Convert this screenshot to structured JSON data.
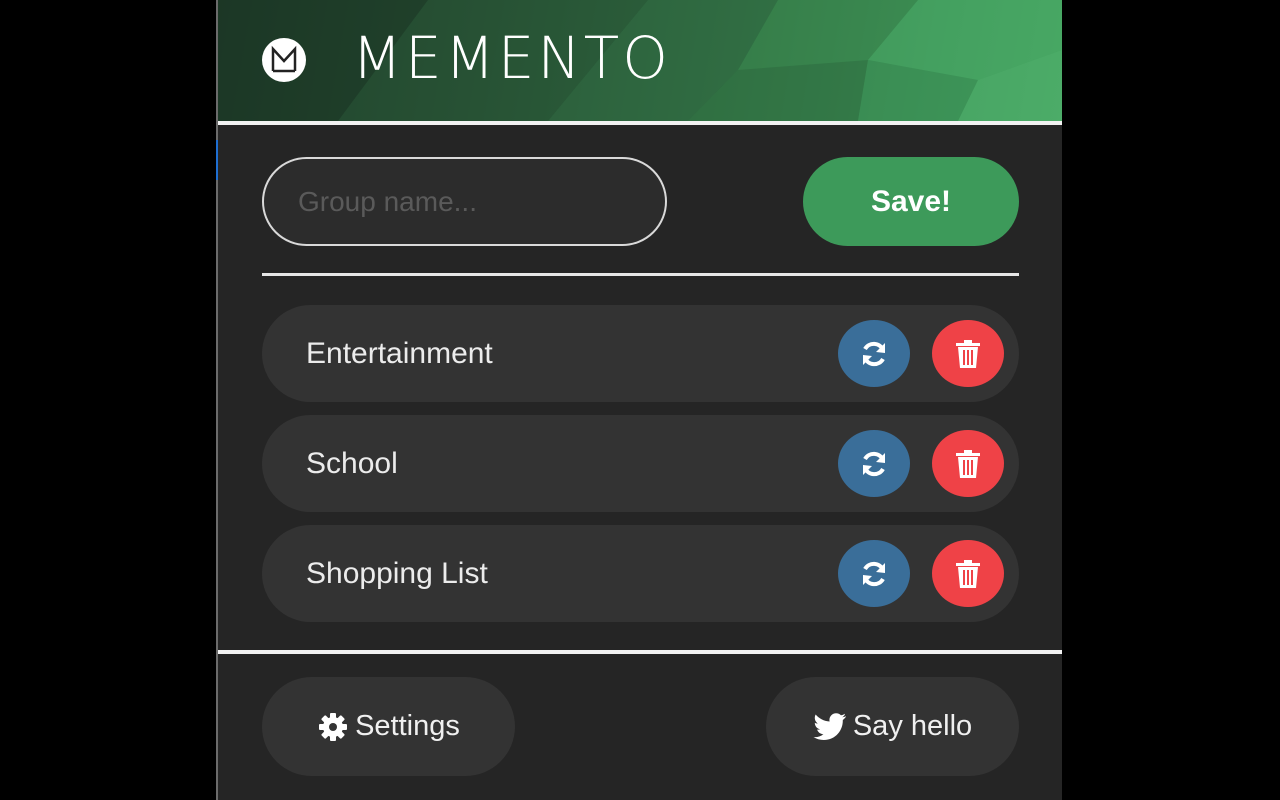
{
  "header": {
    "logo_letter": "M",
    "brand": "MEMENTO"
  },
  "save_form": {
    "placeholder": "Group name...",
    "value": "",
    "save_label": "Save!"
  },
  "groups": [
    {
      "label": "Entertainment"
    },
    {
      "label": "School"
    },
    {
      "label": "Shopping List"
    }
  ],
  "footer": {
    "settings_label": "Settings",
    "hello_label": "Say hello"
  },
  "colors": {
    "accent_green": "#3d9a5a",
    "restore_blue": "#3a6e99",
    "delete_red": "#ef4247",
    "panel_bg": "#252525",
    "item_bg": "#333333"
  },
  "icons": {
    "restore": "refresh-icon",
    "delete": "trash-icon",
    "settings": "gear-icon",
    "hello": "twitter-bird-icon"
  }
}
